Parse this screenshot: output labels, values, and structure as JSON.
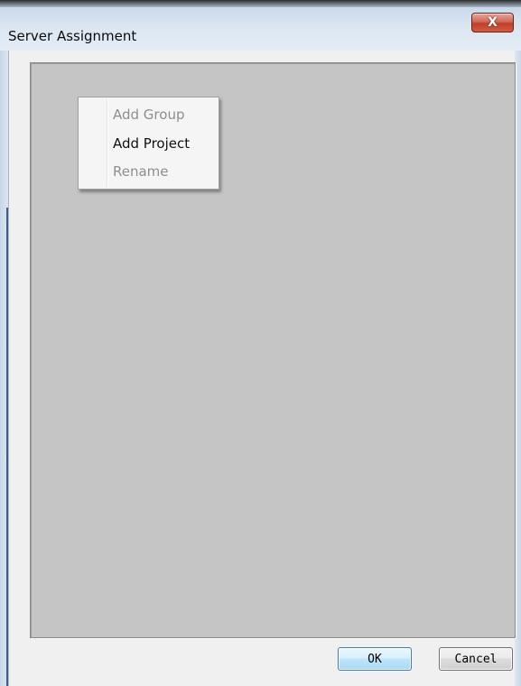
{
  "window": {
    "title": "Server Assignment",
    "close_label": "X"
  },
  "context_menu": {
    "items": [
      {
        "label": "Add Group",
        "enabled": false
      },
      {
        "label": "Add Project",
        "enabled": true
      },
      {
        "label": "Rename",
        "enabled": false
      }
    ]
  },
  "buttons": {
    "ok_label": "OK",
    "cancel_label": "Cancel"
  },
  "colors": {
    "pane_background": "#c5c5c5",
    "title_gradient": "#dbe6f2",
    "close_button": "#c2402a"
  }
}
